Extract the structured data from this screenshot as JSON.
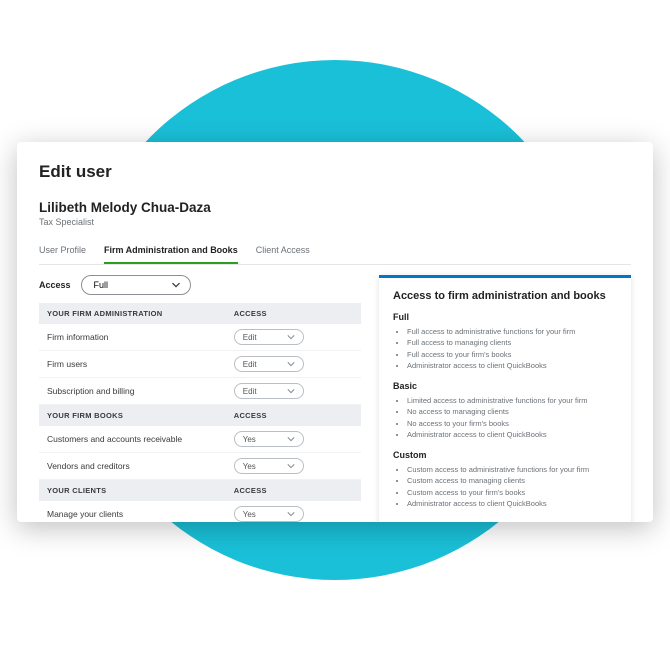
{
  "page": {
    "title": "Edit user"
  },
  "user": {
    "name": "Lilibeth Melody Chua-Daza",
    "role": "Tax Specialist"
  },
  "tabs": [
    {
      "label": "User Profile"
    },
    {
      "label": "Firm Administration and Books"
    },
    {
      "label": "Client Access"
    }
  ],
  "access": {
    "label": "Access",
    "value": "Full"
  },
  "columns": {
    "access": "ACCESS"
  },
  "sections": [
    {
      "header": "YOUR FIRM ADMINISTRATION",
      "rows": [
        {
          "label": "Firm information",
          "value": "Edit"
        },
        {
          "label": "Firm users",
          "value": "Edit"
        },
        {
          "label": "Subscription and billing",
          "value": "Edit"
        }
      ]
    },
    {
      "header": "YOUR FIRM BOOKS",
      "rows": [
        {
          "label": "Customers and accounts receivable",
          "value": "Yes"
        },
        {
          "label": "Vendors and creditors",
          "value": "Yes"
        }
      ]
    },
    {
      "header": "YOUR CLIENTS",
      "rows": [
        {
          "label": "Manage your clients",
          "value": "Yes"
        }
      ]
    }
  ],
  "panel": {
    "title": "Access to firm administration and books",
    "levels": [
      {
        "name": "Full",
        "items": [
          "Full access to administrative functions for your firm",
          "Full access to managing clients",
          "Full access to your firm's books",
          "Administrator access to client QuickBooks"
        ]
      },
      {
        "name": "Basic",
        "items": [
          "Limited access to administrative functions for your firm",
          "No access to managing clients",
          "No access to your firm's books",
          "Administrator access to client QuickBooks"
        ]
      },
      {
        "name": "Custom",
        "items": [
          "Custom access to administrative functions for your firm",
          "Custom access to managing clients",
          "Custom access to your firm's books",
          "Administrator access to client QuickBooks"
        ]
      }
    ]
  }
}
